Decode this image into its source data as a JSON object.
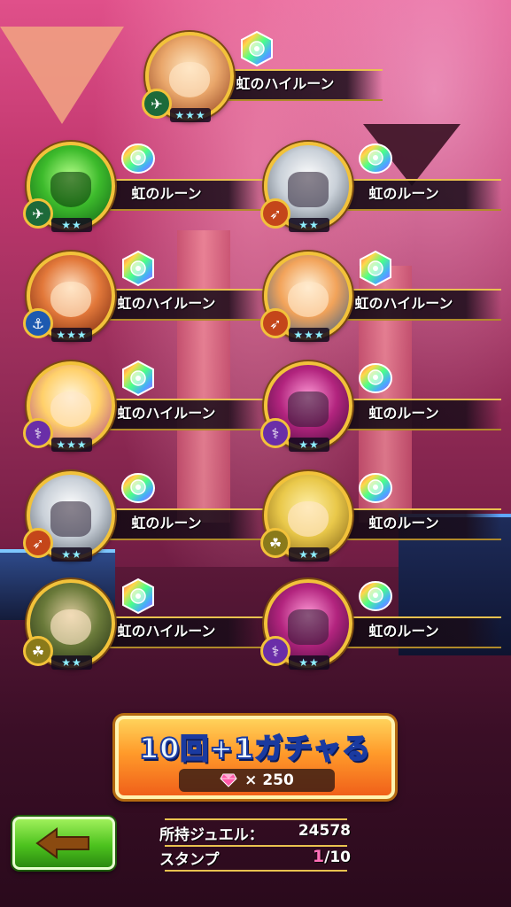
{
  "results": [
    {
      "name": "虹のハイルーン",
      "element": "wind",
      "stars": "★★★",
      "portrait": "bandana-warrior",
      "tier": "high"
    },
    {
      "name": "虹のルーン",
      "element": "wind",
      "stars": "★★",
      "portrait": "green-knight",
      "tier": "normal"
    },
    {
      "name": "虹のルーン",
      "element": "fire",
      "stars": "★★",
      "portrait": "silver-knight",
      "tier": "normal"
    },
    {
      "name": "虹のハイルーン",
      "element": "water",
      "stars": "★★★",
      "portrait": "red-hair-fighter",
      "tier": "high"
    },
    {
      "name": "虹のハイルーン",
      "element": "fire",
      "stars": "★★★",
      "portrait": "cat-girl",
      "tier": "high"
    },
    {
      "name": "虹のハイルーン",
      "element": "dark",
      "stars": "★★★",
      "portrait": "blonde-girl",
      "tier": "high"
    },
    {
      "name": "虹のルーン",
      "element": "dark",
      "stars": "★★",
      "portrait": "purple-knight",
      "tier": "normal"
    },
    {
      "name": "虹のルーン",
      "element": "fire",
      "stars": "★★",
      "portrait": "silver-knight",
      "tier": "normal"
    },
    {
      "name": "虹のルーン",
      "element": "earth",
      "stars": "★★",
      "portrait": "eyepatch-boy",
      "tier": "normal"
    },
    {
      "name": "虹のハイルーン",
      "element": "earth",
      "stars": "★★",
      "portrait": "turban-monster",
      "tier": "high"
    },
    {
      "name": "虹のルーン",
      "element": "dark",
      "stars": "★★",
      "portrait": "purple-knight",
      "tier": "normal"
    }
  ],
  "gacha_button": {
    "label": "10回+1ガチャる",
    "cost_prefix": "× 250",
    "cost_icon": "gem-icon"
  },
  "back_button": {
    "icon": "arrow-left-icon"
  },
  "info": {
    "jewel_label": "所持ジュエル：",
    "jewel_value": "24578",
    "stamp_label": "スタンプ",
    "stamp_current": "1",
    "stamp_total": "/10"
  },
  "colors": {
    "gold_border": "#f2c23a",
    "button_orange": "#ff9a2a",
    "back_green": "#4cc21e",
    "stamp_pink": "#ff6fb8"
  }
}
